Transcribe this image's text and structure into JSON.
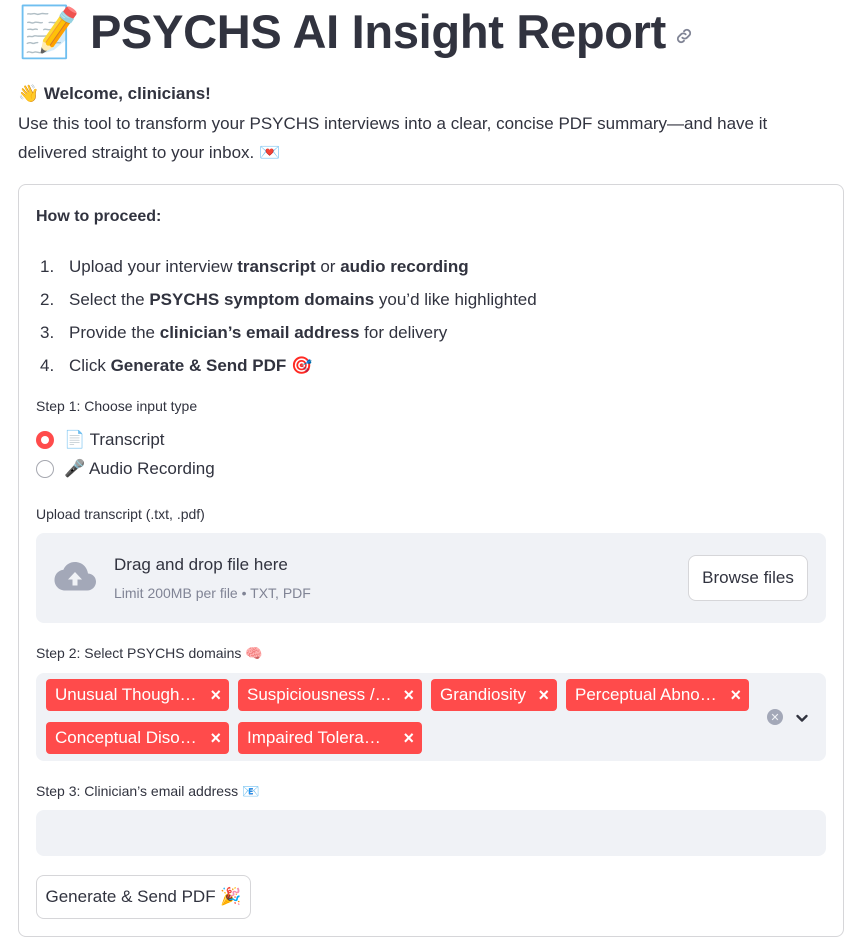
{
  "header": {
    "emoji": "📝",
    "title": "PSYCHS AI Insight Report",
    "link_icon": "link-icon"
  },
  "welcome": {
    "emoji": "👋",
    "text": "Welcome, clinicians!"
  },
  "intro": {
    "text": "Use this tool to transform your PSYCHS interviews into a clear, concise PDF summary—and have it delivered straight to your inbox.",
    "emoji": "💌"
  },
  "instructions": {
    "heading": "How to proceed:",
    "steps": [
      {
        "num": "1.",
        "pre": "Upload your interview ",
        "b1": "transcript",
        "mid": " or ",
        "b2": "audio recording",
        "post": ""
      },
      {
        "num": "2.",
        "pre": "Select the ",
        "b1": "PSYCHS symptom domains",
        "mid": " you’d like highlighted",
        "b2": "",
        "post": ""
      },
      {
        "num": "3.",
        "pre": "Provide the ",
        "b1": "clinician’s email address",
        "mid": " for delivery",
        "b2": "",
        "post": ""
      },
      {
        "num": "4.",
        "pre": "Click ",
        "b1": "Generate & Send PDF",
        "mid": " 🎯",
        "b2": "",
        "post": ""
      }
    ]
  },
  "step1": {
    "label": "Step 1: Choose input type",
    "options": [
      {
        "label": "📄 Transcript",
        "selected": true
      },
      {
        "label": "🎤 Audio Recording",
        "selected": false
      }
    ]
  },
  "upload": {
    "label": "Upload transcript (.txt, .pdf)",
    "drag_text": "Drag and drop file here",
    "limit_text": "Limit 200MB per file • TXT, PDF",
    "browse_label": "Browse files",
    "icon": "cloud-upload-icon"
  },
  "step2": {
    "label": "Step 2: Select PSYCHS domains 🧠",
    "selected": [
      "Unusual Though…",
      "Suspiciousness /…",
      "Grandiosity",
      "Perceptual Abno…",
      "Conceptual Diso…",
      "Impaired Tolera…"
    ],
    "remove_glyph": "×",
    "accent_color": "#ff4b4b"
  },
  "step3": {
    "label": "Step 3: Clinician’s email address 📧",
    "value": ""
  },
  "submit": {
    "label": "Generate & Send PDF 🎉"
  }
}
